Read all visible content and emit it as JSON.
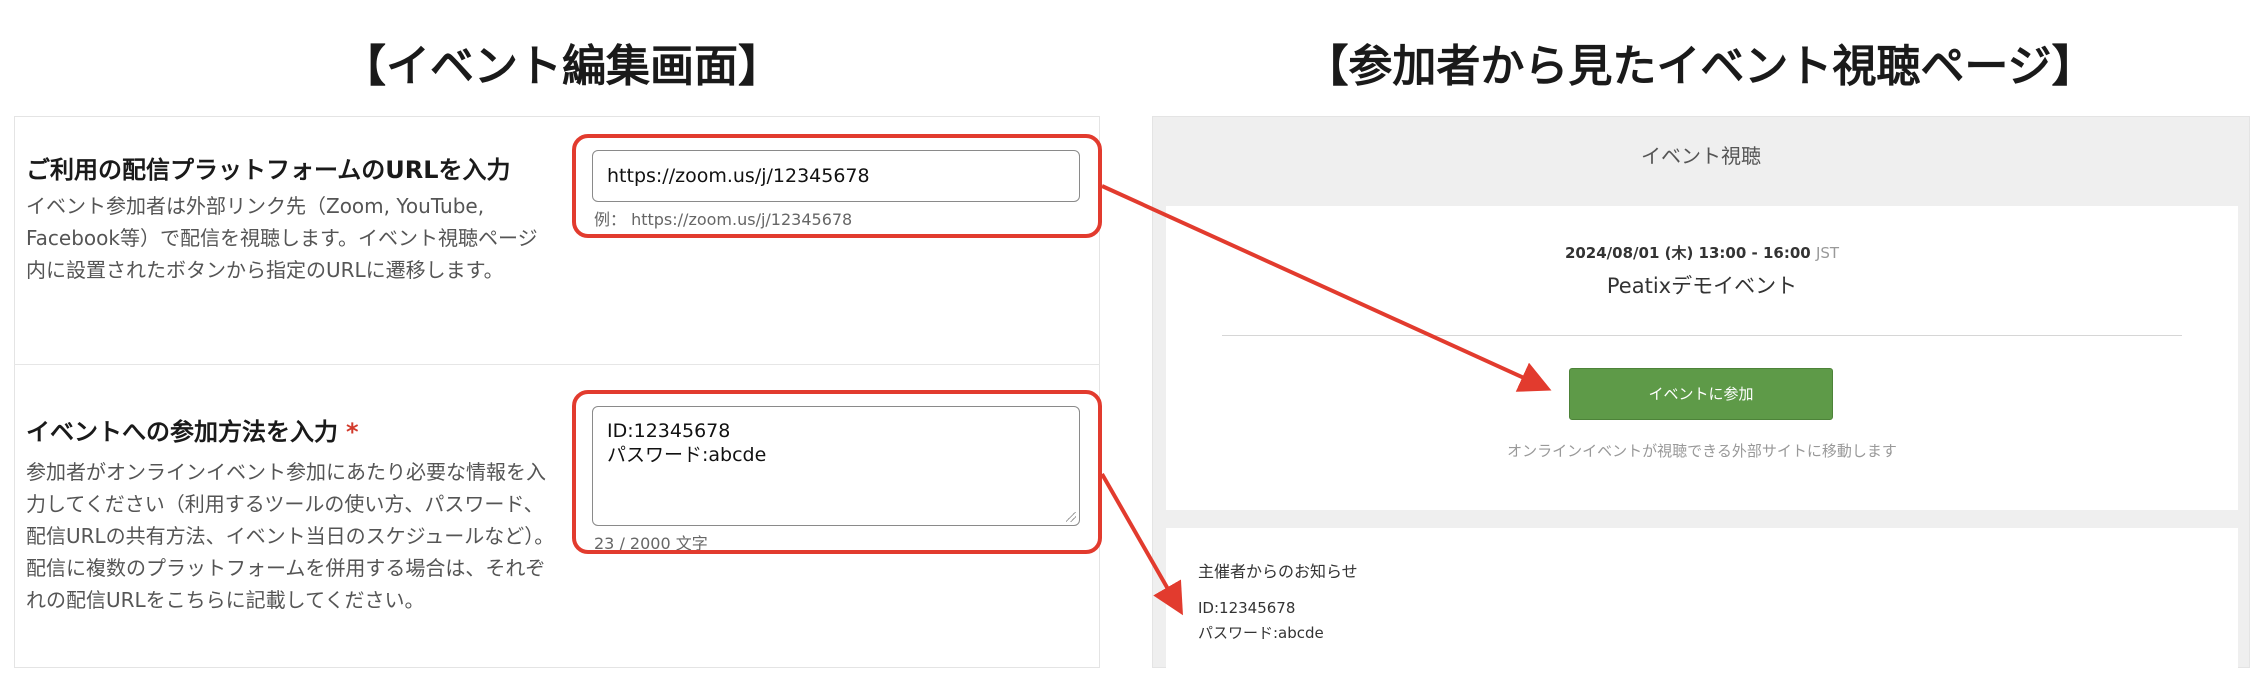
{
  "left_heading": "【イベント編集画面】",
  "right_heading": "【参加者から見たイベント視聴ページ】",
  "edit": {
    "url_section": {
      "title": "ご利用の配信プラットフォームのURLを入力",
      "description": "イベント参加者は外部リンク先（Zoom, YouTube, Facebook等）で配信を視聴します。イベント視聴ページ内に設置されたボタンから指定のURLに遷移します。",
      "input_value": "https://zoom.us/j/12345678",
      "example_hint": "例： https://zoom.us/j/12345678"
    },
    "method_section": {
      "title": "イベントへの参加方法を入力",
      "required_mark": "*",
      "description": "参加者がオンラインイベント参加にあたり必要な情報を入力してください（利用するツールの使い方、パスワード、配信URLの共有方法、イベント当日のスケジュールなど）。配信に複数のプラットフォームを併用する場合は、それぞれの配信URLをこちらに記載してください。",
      "textarea_value": "ID:12345678\nパスワード:abcde",
      "char_count": "23 / 2000 文字"
    }
  },
  "view": {
    "title": "イベント視聴",
    "date": "2024/08/01 (木) 13:00 - 16:00",
    "timezone": "JST",
    "event_name": "Peatixデモイベント",
    "join_button": "イベントに参加",
    "note": "オンラインイベントが視聴できる外部サイトに移動します",
    "notice_title": "主催者からのお知らせ",
    "notice_body": "ID:12345678\nパスワード:abcde"
  },
  "colors": {
    "highlight": "#e23b2e",
    "join_button": "#5e9a48",
    "required": "#d23a2c"
  }
}
